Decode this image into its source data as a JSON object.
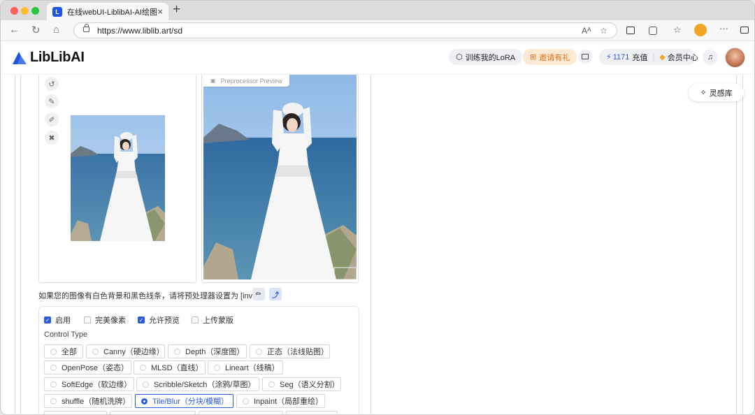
{
  "browser": {
    "tab_title": "在线webUI-LiblibAI-AI绘图工具",
    "favicon": "L",
    "tab_close": "×",
    "new_tab": "+",
    "url": "https://www.liblib.art/sd",
    "back": "←",
    "reload": "↻",
    "home": "⌂",
    "read_aloud": "Aᴬ",
    "star": "☆",
    "more": "···"
  },
  "header": {
    "logo_text": "LibLibAI",
    "train_lora": "训练我的LoRA",
    "invite": "邀请有礼",
    "credits": "1171",
    "recharge": "充值",
    "membership": "会员中心"
  },
  "inspiration": "灵感库",
  "preview_label": "Preprocessor Preview",
  "hint_text": "如果您的图像有白色背景和黑色线条，请将预处理器设置为 [invert].",
  "checkboxes": [
    {
      "label": "启用",
      "checked": true
    },
    {
      "label": "完美像素",
      "checked": false
    },
    {
      "label": "允许预览",
      "checked": true
    },
    {
      "label": "上传蒙版",
      "checked": false
    }
  ],
  "control_type_label": "Control Type",
  "control_types": [
    {
      "label": "全部"
    },
    {
      "label": "Canny（硬边缘）"
    },
    {
      "label": "Depth（深度图）"
    },
    {
      "label": "正态（法线贴图）"
    },
    {
      "label": "OpenPose（姿态）"
    },
    {
      "label": "MLSD（直线）"
    },
    {
      "label": "Lineart（线稿）"
    },
    {
      "label": "SoftEdge（软边缘）"
    },
    {
      "label": "Scribble/Sketch（涂鸦/草图）"
    },
    {
      "label": "Seg（语义分割）"
    },
    {
      "label": "shuffle（随机洗牌）"
    },
    {
      "label": "Tile/Blur（分块/模糊）",
      "selected": true
    },
    {
      "label": "Inpaint（局部重绘）"
    }
  ],
  "colors": {
    "accent": "#2a5be0",
    "invite_bg": "#fde9d2",
    "invite_text": "#d9711b"
  }
}
